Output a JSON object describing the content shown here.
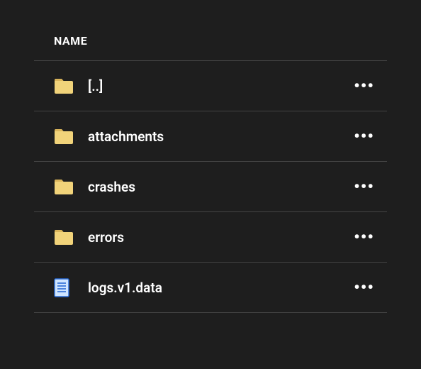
{
  "header": {
    "name_label": "NAME"
  },
  "items": [
    {
      "label": "[..]",
      "kind": "folder"
    },
    {
      "label": "attachments",
      "kind": "folder"
    },
    {
      "label": "crashes",
      "kind": "folder"
    },
    {
      "label": "errors",
      "kind": "folder"
    },
    {
      "label": "logs.v1.data",
      "kind": "file"
    }
  ],
  "icons": {
    "folder_fill": "#f1d37a",
    "folder_shadow": "#d9b45a",
    "file_fill": "#cfe5ff",
    "file_line": "#2a6bd6"
  }
}
